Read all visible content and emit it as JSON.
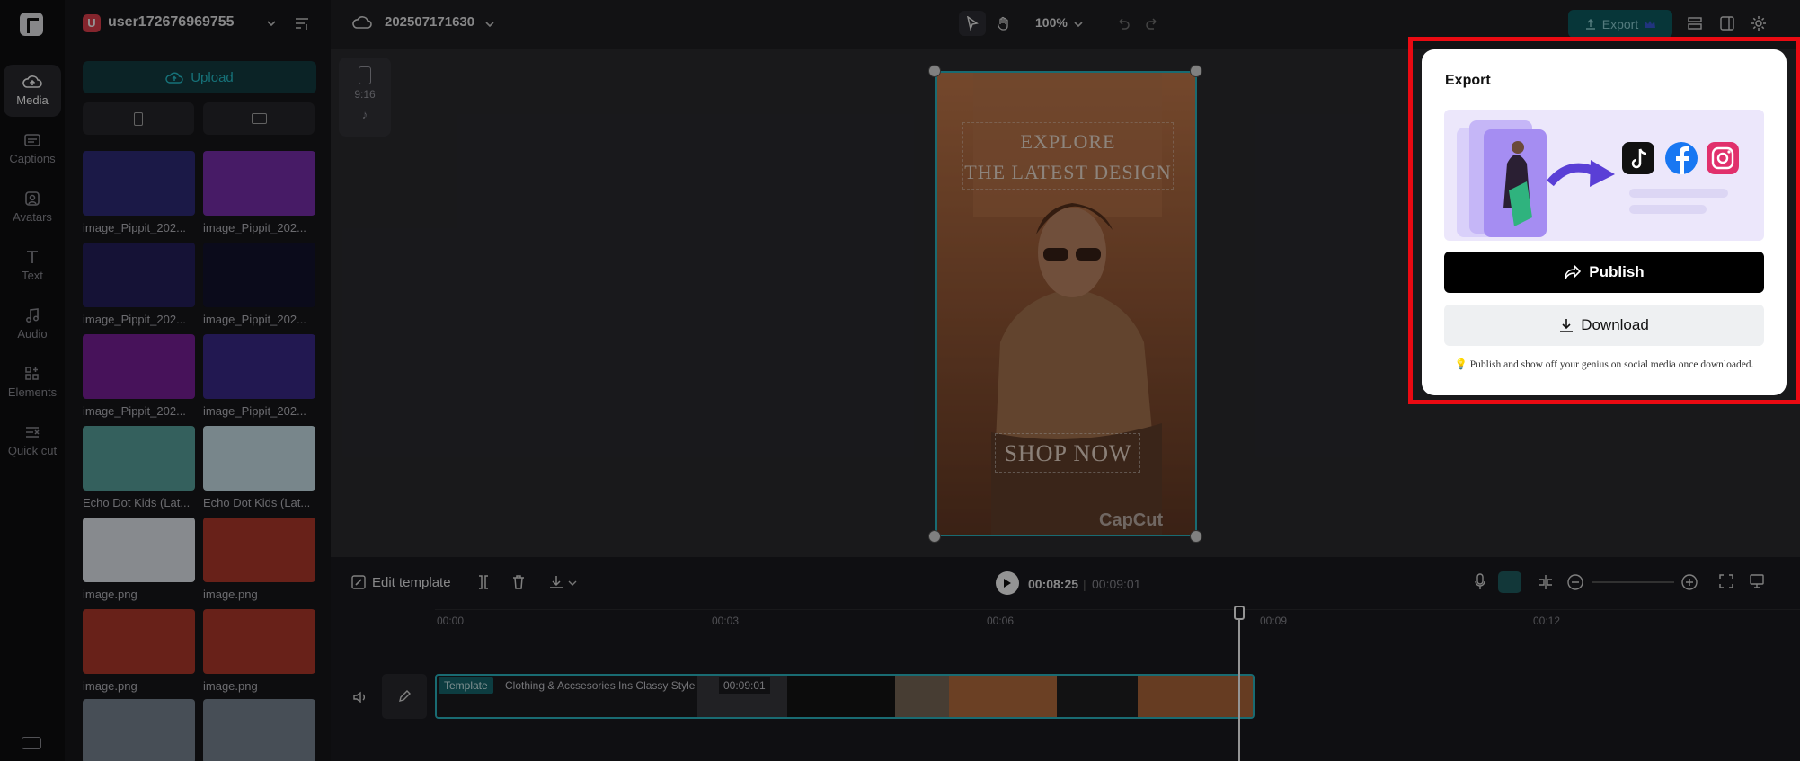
{
  "rail": {
    "items": [
      {
        "label": "Media",
        "icon": "cloud-upload-icon"
      },
      {
        "label": "Captions",
        "icon": "captions-icon"
      },
      {
        "label": "Avatars",
        "icon": "avatar-icon"
      },
      {
        "label": "Text",
        "icon": "text-icon"
      },
      {
        "label": "Audio",
        "icon": "music-note-icon"
      },
      {
        "label": "Elements",
        "icon": "elements-icon"
      },
      {
        "label": "Quick cut",
        "icon": "quick-cut-icon"
      }
    ]
  },
  "panel": {
    "user_initial": "U",
    "user_name": "user172676969755...",
    "upload_label": "Upload",
    "items": [
      {
        "label": "image_Pippit_202...",
        "color": "#2f2b7a"
      },
      {
        "label": "image_Pippit_202...",
        "color": "#7a2fb0"
      },
      {
        "label": "image_Pippit_202...",
        "color": "#25205e"
      },
      {
        "label": "image_Pippit_202...",
        "color": "#141430"
      },
      {
        "label": "image_Pippit_202...",
        "color": "#7a1f9c"
      },
      {
        "label": "image_Pippit_202...",
        "color": "#3b2a8c"
      },
      {
        "label": "Echo Dot Kids (Lat...",
        "color": "#5aa6a0"
      },
      {
        "label": "Echo Dot Kids (Lat...",
        "color": "#cfe7ef"
      },
      {
        "label": "image.png",
        "color": "#e9eef5"
      },
      {
        "label": "image.png",
        "color": "#b33a2c"
      },
      {
        "label": "image.png",
        "color": "#b33a2c"
      },
      {
        "label": "image.png",
        "color": "#b33a2c"
      },
      {
        "label": "",
        "color": "#7a8794"
      },
      {
        "label": "",
        "color": "#7a8794"
      }
    ]
  },
  "topbar": {
    "project_name": "202507171630",
    "zoom": "100%",
    "export_label": "Export"
  },
  "canvas": {
    "ratio": "9:16",
    "headline_line1": "EXPLORE",
    "headline_line2": "THE LATEST DESIGN",
    "cta": "SHOP NOW",
    "watermark": "CapCut"
  },
  "timeline": {
    "edit_template": "Edit template",
    "current_time": "00:08:25",
    "total_time": "00:09:01",
    "ruler": [
      "00:00",
      "00:03",
      "00:06",
      "00:09",
      "00:12"
    ],
    "clip_badge": "Template",
    "clip_title": "Clothing & Accsesories Ins Classy Style",
    "clip_duration": "00:09:01"
  },
  "export_popover": {
    "title": "Export",
    "publish_label": "Publish",
    "download_label": "Download",
    "tip": "Publish and show off your genius on social media once downloaded.",
    "tip_icon": "lightbulb-icon",
    "social_icons": [
      "tiktok-icon",
      "facebook-icon",
      "instagram-icon"
    ]
  },
  "colors": {
    "accent": "#2bb8c4",
    "highlight": "#ea0a12",
    "publish_bg": "#000000"
  }
}
